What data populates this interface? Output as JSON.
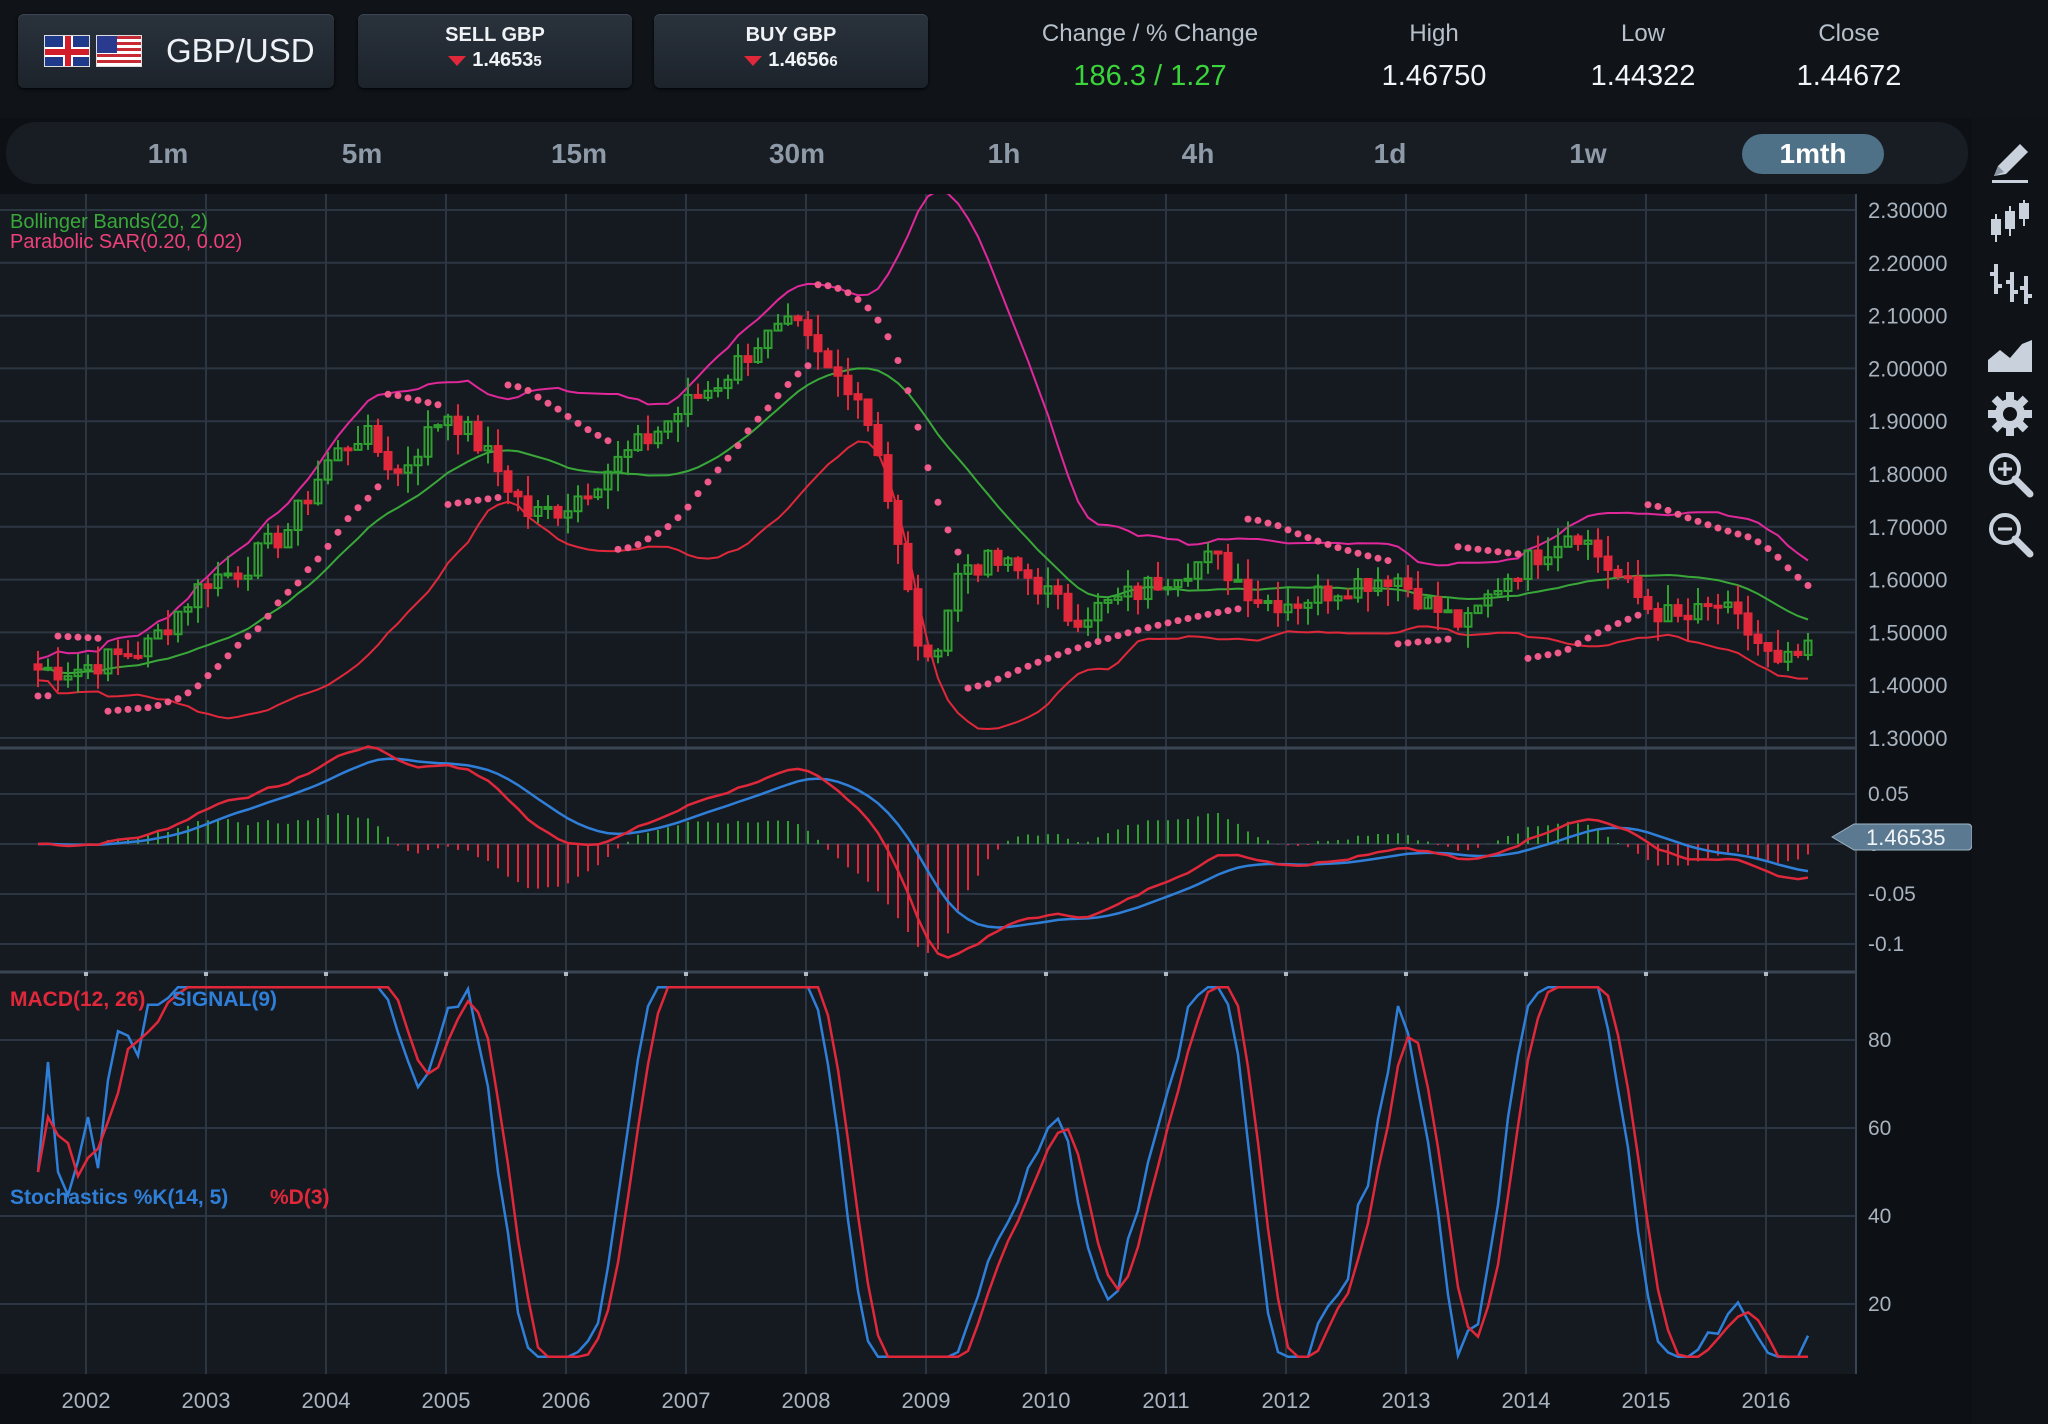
{
  "header": {
    "pair": "GBP/USD",
    "sell": {
      "label": "SELL GBP",
      "price_main": "1.4653",
      "price_pip": "5"
    },
    "buy": {
      "label": "BUY GBP",
      "price_main": "1.4656",
      "price_pip": "6"
    },
    "stats": [
      {
        "label": "Change / % Change",
        "value": "186.3 / 1.27",
        "color": "#3bd43b"
      },
      {
        "label": "High",
        "value": "1.46750"
      },
      {
        "label": "Low",
        "value": "1.44322"
      },
      {
        "label": "Close",
        "value": "1.44672"
      }
    ]
  },
  "timeframes": [
    "1m",
    "5m",
    "15m",
    "30m",
    "1h",
    "4h",
    "1d",
    "1w",
    "1mth"
  ],
  "active_timeframe": "1mth",
  "sidebar_icons": [
    "pencil-icon",
    "candlestick-icon",
    "ohlc-bars-icon",
    "area-chart-icon",
    "gear-icon",
    "zoom-in-icon",
    "zoom-out-icon"
  ],
  "chart_data": {
    "type": "line",
    "instrument": "GBP/USD",
    "overlays": [
      {
        "text": "Bollinger Bands(20, 2)",
        "color": "#39a839"
      },
      {
        "text": "Parabolic SAR(0.20, 0.02)",
        "color": "#f0407a"
      }
    ],
    "price_axis": [
      "2.30000",
      "2.20000",
      "2.10000",
      "2.00000",
      "1.90000",
      "1.80000",
      "1.70000",
      "1.60000",
      "1.50000",
      "1.40000",
      "1.30000"
    ],
    "ylim": [
      1.3,
      2.3
    ],
    "current_price_tag": "1.46535",
    "x_labels": [
      "2002",
      "2003",
      "2004",
      "2005",
      "2006",
      "2007",
      "2008",
      "2009",
      "2010",
      "2011",
      "2012",
      "2013",
      "2014",
      "2015",
      "2016"
    ],
    "price_close": {
      "x": [
        2001.9,
        2002.5,
        2003.0,
        2003.3,
        2003.7,
        2004.0,
        2004.3,
        2004.6,
        2005.0,
        2005.3,
        2005.7,
        2006.0,
        2006.3,
        2006.7,
        2007.0,
        2007.3,
        2007.6,
        2007.9,
        2008.2,
        2008.4,
        2008.6,
        2008.8,
        2009.0,
        2009.3,
        2009.6,
        2009.9,
        2010.2,
        2010.5,
        2010.8,
        2011.1,
        2011.4,
        2011.8,
        2012.1,
        2012.5,
        2012.9,
        2013.2,
        2013.5,
        2013.8,
        2014.1,
        2014.4,
        2014.7,
        2015.0,
        2015.3,
        2015.6,
        2015.9,
        2016.1,
        2016.3
      ],
      "y": [
        1.43,
        1.47,
        1.6,
        1.62,
        1.7,
        1.82,
        1.88,
        1.8,
        1.92,
        1.85,
        1.72,
        1.74,
        1.8,
        1.87,
        1.93,
        1.98,
        2.05,
        2.08,
        1.99,
        1.97,
        1.85,
        1.62,
        1.42,
        1.63,
        1.63,
        1.6,
        1.53,
        1.55,
        1.58,
        1.62,
        1.64,
        1.56,
        1.56,
        1.59,
        1.61,
        1.55,
        1.51,
        1.6,
        1.65,
        1.7,
        1.62,
        1.55,
        1.52,
        1.55,
        1.49,
        1.43,
        1.46
      ]
    },
    "macd": {
      "label_macd": "MACD(12, 26)",
      "label_signal": "SIGNAL(9)",
      "axis": [
        "0.05",
        "0",
        "-0.05",
        "-0.1"
      ],
      "ylim": [
        -0.12,
        0.08
      ]
    },
    "stochastics": {
      "label": "Stochastics %K(14, 5)",
      "label_d": "%D(3)",
      "axis": [
        "80",
        "60",
        "40",
        "20"
      ],
      "ylim": [
        5,
        95
      ]
    }
  }
}
